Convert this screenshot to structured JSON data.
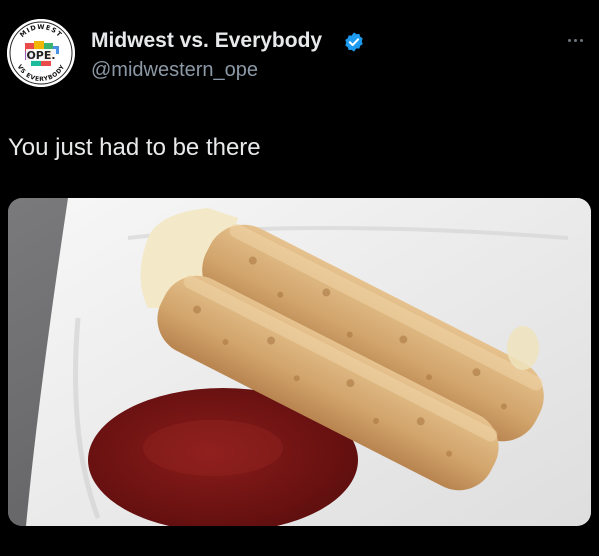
{
  "tweet": {
    "display_name": "Midwest vs. Everybody",
    "handle": "@midwestern_ope",
    "text": "You just had to be there",
    "verified_color": "#1d9bf0",
    "more_icon": "more-horizontal-icon"
  },
  "avatar": {
    "top_text": "MIDWEST",
    "center_text": "OPE.",
    "bottom_text": "VS EVERYBODY"
  },
  "media": {
    "subject": "photo",
    "colors": {
      "background": "#6a6a6c",
      "plate": "#f1f1f1",
      "sauce": "#7a1414",
      "breadstick": "#d9b27c"
    }
  }
}
